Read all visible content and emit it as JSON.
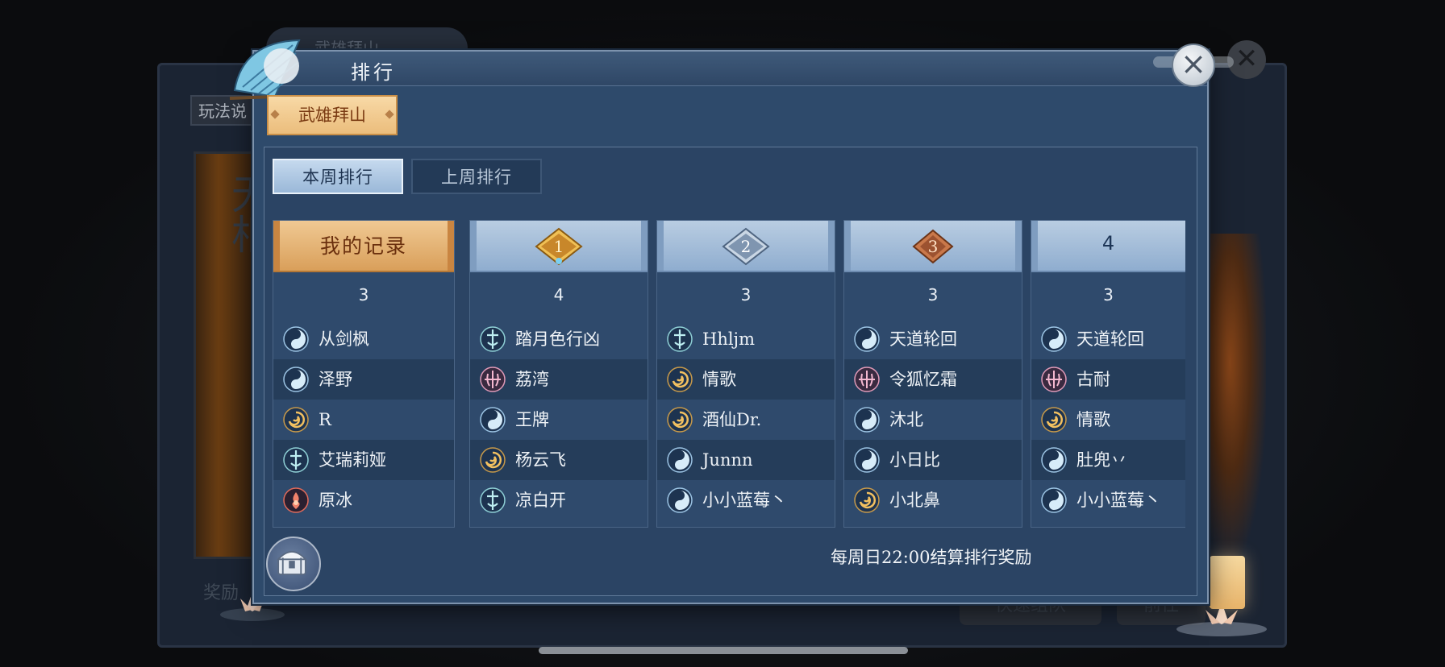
{
  "background": {
    "mode_title": "武雄拜山",
    "rules_button": "玩法说",
    "scroll_text": "无相",
    "bottom_buttons": [
      "奖励",
      "排行"
    ],
    "right_buttons": [
      "快速组队",
      "前往"
    ]
  },
  "dialog": {
    "title": "排行",
    "close_icon": "close-icon",
    "mode_tab": "武雄拜山",
    "week_tabs": {
      "this_week": "本周排行",
      "last_week": "上周排行"
    },
    "active_week": "this_week",
    "footer_note": "每周日22:00结算排行奖励"
  },
  "my_record": {
    "header": "我的记录",
    "count": "3",
    "members": [
      {
        "name": "从剑枫",
        "school": "taiji"
      },
      {
        "name": "泽野",
        "school": "taiji"
      },
      {
        "name": "R",
        "school": "swirl"
      },
      {
        "name": "艾瑞莉娅",
        "school": "sword"
      },
      {
        "name": "原冰",
        "school": "flame"
      }
    ]
  },
  "rankings": [
    {
      "rank": "1",
      "rank_icon": "gold-rank-badge-icon",
      "count": "4",
      "members": [
        {
          "name": "踏月色行凶",
          "school": "sword"
        },
        {
          "name": "荔湾",
          "school": "pink-claw"
        },
        {
          "name": "王牌",
          "school": "taiji"
        },
        {
          "name": "杨云飞",
          "school": "swirl"
        },
        {
          "name": "凉白开",
          "school": "sword"
        }
      ]
    },
    {
      "rank": "2",
      "rank_icon": "silver-rank-badge-icon",
      "count": "3",
      "members": [
        {
          "name": "Hhljm",
          "school": "sword"
        },
        {
          "name": "情歌",
          "school": "swirl"
        },
        {
          "name": "酒仙Dr.",
          "school": "swirl"
        },
        {
          "name": "Junnn",
          "school": "taiji"
        },
        {
          "name": "小小蓝莓丶",
          "school": "taiji"
        }
      ]
    },
    {
      "rank": "3",
      "rank_icon": "bronze-rank-badge-icon",
      "count": "3",
      "members": [
        {
          "name": "天道轮回",
          "school": "taiji"
        },
        {
          "name": "令狐忆霜",
          "school": "pink-claw"
        },
        {
          "name": "沐北",
          "school": "taiji"
        },
        {
          "name": "小日比",
          "school": "taiji"
        },
        {
          "name": "小北鼻",
          "school": "swirl"
        }
      ]
    },
    {
      "rank": "4",
      "rank_icon": "",
      "count": "3",
      "members": [
        {
          "name": "天道轮回",
          "school": "taiji"
        },
        {
          "name": "古耐",
          "school": "pink-claw"
        },
        {
          "name": "情歌",
          "school": "swirl"
        },
        {
          "name": "肚兜丷",
          "school": "taiji"
        },
        {
          "name": "小小蓝莓丶",
          "school": "taiji"
        }
      ]
    }
  ],
  "colors": {
    "panel": "#2e4a6b",
    "mine_header": "#e8b46a",
    "rank_header": "#a9c1db",
    "gold": "#d89a2e",
    "silver": "#8fa6bf",
    "bronze": "#b86a3a"
  }
}
